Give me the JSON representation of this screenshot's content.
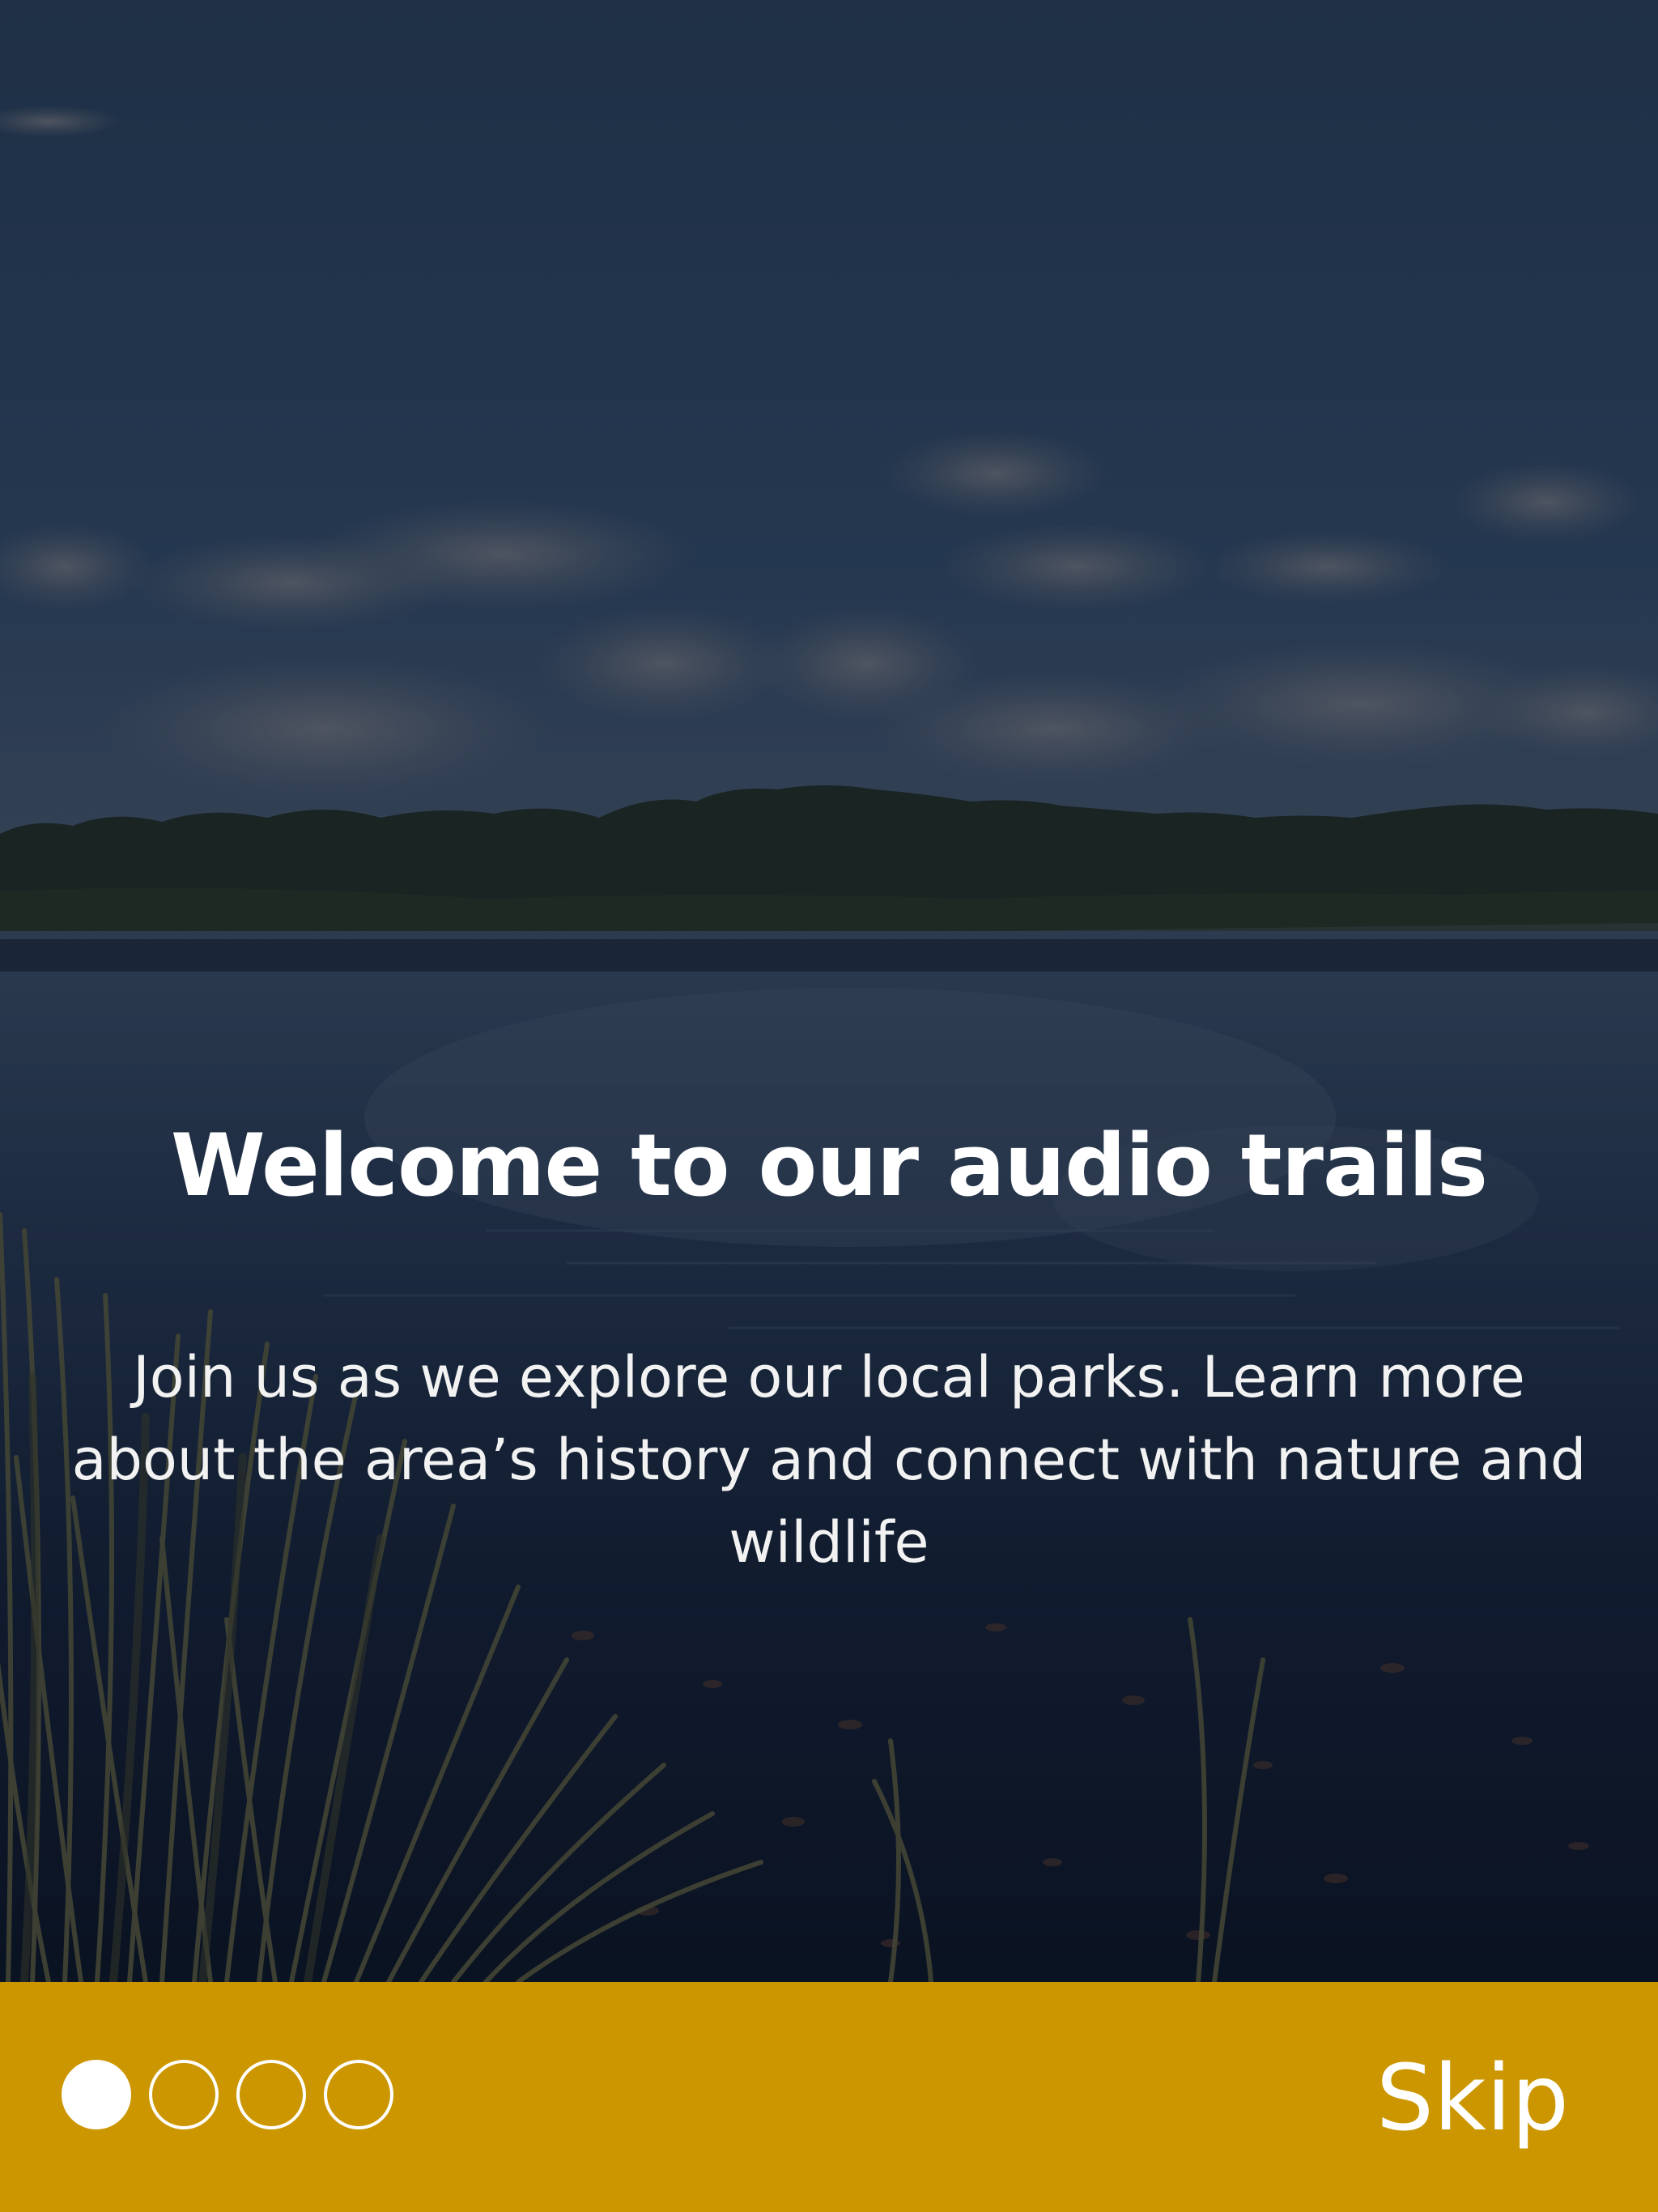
{
  "onboarding": {
    "title": "Welcome to our audio trails",
    "body": "Join us as we explore our local parks. Learn more about the area’s history and connect with nature and wildlife",
    "background_image": "lake-with-trees-and-reeds-photo"
  },
  "footer": {
    "background_color": "#cc9600",
    "pager": {
      "total_pages": 4,
      "current_page": 1
    },
    "skip_label": "Skip"
  }
}
